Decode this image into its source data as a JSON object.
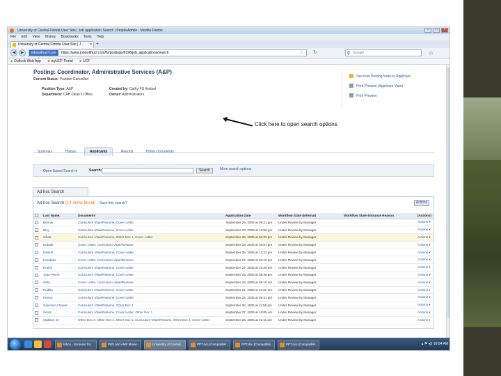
{
  "browser": {
    "window_title": "University of Central Florida User Site | Job application Search | PeopleAdmin - Mozilla Firefox",
    "menu": [
      "File",
      "Edit",
      "View",
      "History",
      "Bookmarks",
      "Tools",
      "Help"
    ],
    "tab_label": "University of Central Florida User Site | J...",
    "new_tab": "+",
    "url_site": "jobswithucf.com",
    "url": "https://www.jobswithucf.com/hr/postings/6196/job_applications/search",
    "search_placeholder": "Google",
    "bookmarks": [
      "Outlook Web App",
      "myUCF Portal",
      "UCF"
    ]
  },
  "posting": {
    "title": "Posting: Coordinator, Administrative Services (A&P)",
    "status_label": "Current Status:",
    "status_value": "Position Cancelled",
    "type_label": "Position Type:",
    "type_value": "A&P",
    "dept_label": "Department:",
    "dept_value": "CAH-Dean's Office",
    "created_label": "Created by:",
    "created_value": "Cathy-FU Kedzel",
    "owner_label": "Owner:",
    "owner_value": "Administrators",
    "side_links": [
      "See how Posting looks to Applicant",
      "Print Preview (Applicant View)",
      "Print Preview"
    ]
  },
  "tabs": [
    "Summary",
    "History",
    "Applicants",
    "Reports",
    "Hiring Documents"
  ],
  "active_tab": "Applicants",
  "search": {
    "open_saved": "Open Saved Search ▾",
    "label": "Search:",
    "button": "Search",
    "more_options": "More search options"
  },
  "callout": "Click here to open search options",
  "results": {
    "tab_title": "Ad hoc Search",
    "heading": "Ad hoc Search",
    "found": "(14 items found)",
    "save": "Save this search?",
    "actions_button": "Actions",
    "columns": [
      "Last Name:",
      "Documents",
      "Application Date",
      "Workflow State (Internal)",
      "Workflow State Entrance Reason",
      "(Actions)"
    ],
    "rows": [
      {
        "last": "Benner",
        "docs": "Curriculum Vitae/Resume, Cover Letter",
        "date": "September 26, 2005 at 09:21 am",
        "state": "Under Review by Manager",
        "reason": "",
        "act": "Actions ▾"
      },
      {
        "last": "Bicy",
        "docs": "Curriculum Vitae/Resume, Cover Letter",
        "date": "September 23, 2005 at 12:50 pm",
        "state": "Under Review by Manager",
        "reason": "",
        "act": "Actions ▾"
      },
      {
        "last": "Cillas",
        "docs": "Curriculum Vitae/Resume, Other Doc 1, Cover Letter",
        "date": "September 26, 2005 at 04:33 pm",
        "state": "Under Review by Manager",
        "reason": "",
        "act": "Actions ▾"
      },
      {
        "last": "Dufault",
        "docs": "Cover Letter, Curriculum Vitae/Resume",
        "date": "September 23, 2005 at 02:57 pm",
        "state": "Under Review by Manager",
        "reason": "",
        "act": "Actions ▾"
      },
      {
        "last": "Esterill",
        "docs": "Curriculum Vitae/Resume, Cover Letter",
        "date": "September 26, 2005 at 12:22 pm",
        "state": "Under Review by Manager",
        "reason": "",
        "act": "Actions ▾"
      },
      {
        "last": "Hendeler",
        "docs": "Cover Letter, Curriculum Vitae/Resume",
        "date": "September 27, 2005 at 04:10 pm",
        "state": "Under Review by Manager",
        "reason": "",
        "act": "Actions ▾"
      },
      {
        "last": "Hurley",
        "docs": "Curriculum Vitae/Resume, Cover Letter",
        "date": "September 27, 2005 at 10:29 am",
        "state": "Under Review by Manager",
        "reason": "",
        "act": "Actions ▾"
      },
      {
        "last": "Jean-Pierre",
        "docs": "Curriculum Vitae/Resume, Cover Letter",
        "date": "September 25, 2005 at 05:48 pm",
        "state": "Under Review by Manager",
        "reason": "",
        "act": "Actions ▾"
      },
      {
        "last": "Ortin",
        "docs": "Cover Letter, Curriculum Vitae/Resume",
        "date": "September 24, 2005 at 09:10 am",
        "state": "Under Review by Manager",
        "reason": "",
        "act": "Actions ▾"
      },
      {
        "last": "Padilla",
        "docs": "Curriculum Vitae/Resume, Cover Letter",
        "date": "September 27, 2005 at 11:32 am",
        "state": "Under Review by Manager",
        "reason": "",
        "act": "Actions ▾"
      },
      {
        "last": "Parton",
        "docs": "Curriculum Vitae/Resume, Cover Letter",
        "date": "September 24, 2005 at 08:41 pm",
        "state": "Under Review by Manager",
        "reason": "",
        "act": "Actions ▾"
      },
      {
        "last": "Sanchez-Chavez",
        "docs": "Curriculum Vitae/Resume, Other Doc 1",
        "date": "September 26, 2005 at 11:58 pm",
        "state": "Under Review by Manager",
        "reason": "",
        "act": "Actions ▾"
      },
      {
        "last": "Scism",
        "docs": "Curriculum Vitae/Resume, Cover Letter, Other Doc 1",
        "date": "September 27, 2005 at 10:05 am",
        "state": "Under Review by Manager",
        "reason": "",
        "act": "Actions ▾"
      },
      {
        "last": "Stallard, Sr",
        "docs": "Other Doc 3, Other Doc 2, Other Doc 1, Curriculum Vitae/Resume, Other Doc 4, Cover Letter",
        "date": "September 28, 2005 at 01:11 pm",
        "state": "Under Review by Manager",
        "reason": "",
        "act": "Actions ▾"
      }
    ],
    "highlight_index": 2
  },
  "taskbar": {
    "buttons": [
      "Inbox - Screenie for...",
      "PBS and AMP Movie...",
      "University of Central...",
      "PPT.doc [Compatibili...",
      "PPT.doc [Compatibili...",
      "PPT.doc [Compatibili..."
    ],
    "time": "10:04 AM"
  }
}
